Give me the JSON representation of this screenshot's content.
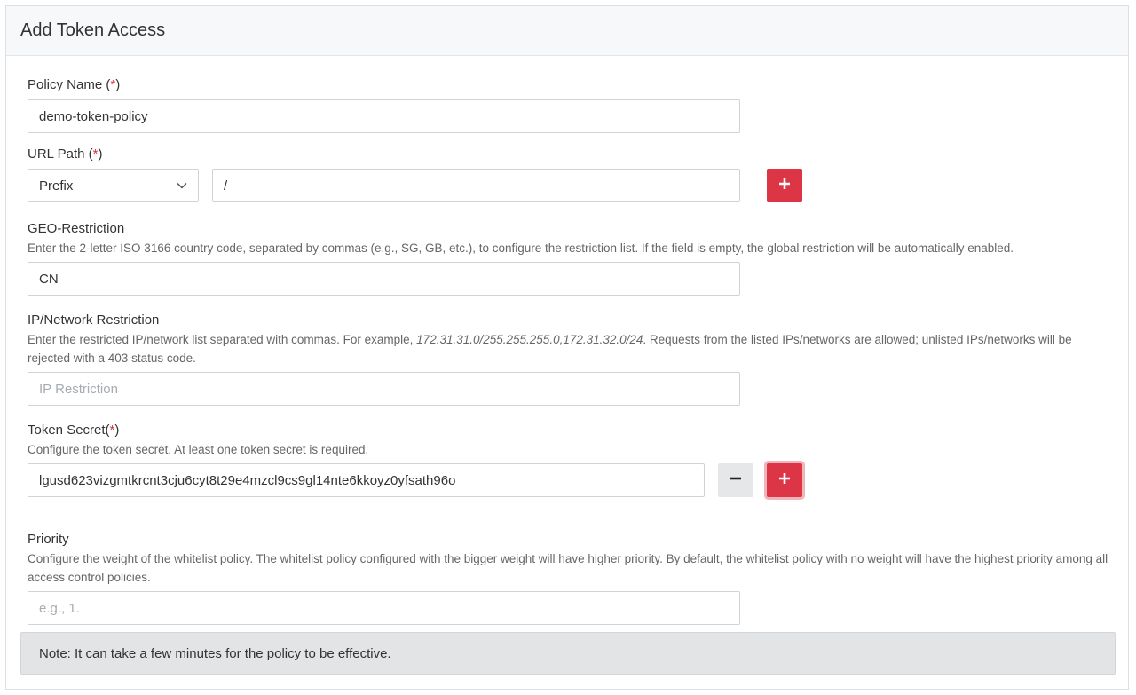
{
  "header": {
    "title": "Add Token Access"
  },
  "policy_name": {
    "label": "Policy Name (",
    "required_mark": "*",
    "label_end": ")",
    "value": "demo-token-policy"
  },
  "url_path": {
    "label": "URL Path (",
    "required_mark": "*",
    "label_end": ")",
    "match_type": "Prefix",
    "value": "/",
    "add_icon": "plus-icon"
  },
  "geo": {
    "label": "GEO-Restriction",
    "help": "Enter the 2-letter ISO 3166 country code, separated by commas (e.g., SG, GB, etc.), to configure the restriction list. If the field is empty, the global restriction will be automatically enabled.",
    "value": "CN"
  },
  "ip": {
    "label": "IP/Network Restriction",
    "help_prefix": "Enter the restricted IP/network list separated with commas. For example, ",
    "help_example": "172.31.31.0/255.255.255.0,172.31.32.0/24",
    "help_suffix": ". Requests from the listed IPs/networks are allowed; unlisted IPs/networks will be rejected with a 403 status code.",
    "placeholder": "IP Restriction",
    "value": ""
  },
  "token_secret": {
    "label": "Token Secret(",
    "required_mark": "*",
    "label_end": ")",
    "help": "Configure the token secret. At least one token secret is required.",
    "value": "lgusd623vizgmtkrcnt3cju6cyt8t29e4mzcl9cs9gl14nte6kkoyz0yfsath96o",
    "remove_icon": "minus-icon",
    "add_icon": "plus-icon"
  },
  "priority": {
    "label": "Priority",
    "help": "Configure the weight of the whitelist policy. The whitelist policy configured with the bigger weight will have higher priority. By default, the whitelist policy with no weight will have the highest priority among all access control policies.",
    "placeholder": "e.g., 1.",
    "value": ""
  },
  "note": "Note: It can take a few minutes for the policy to be effective.",
  "colors": {
    "accent": "#dc3545",
    "required": "#e02d3c"
  }
}
